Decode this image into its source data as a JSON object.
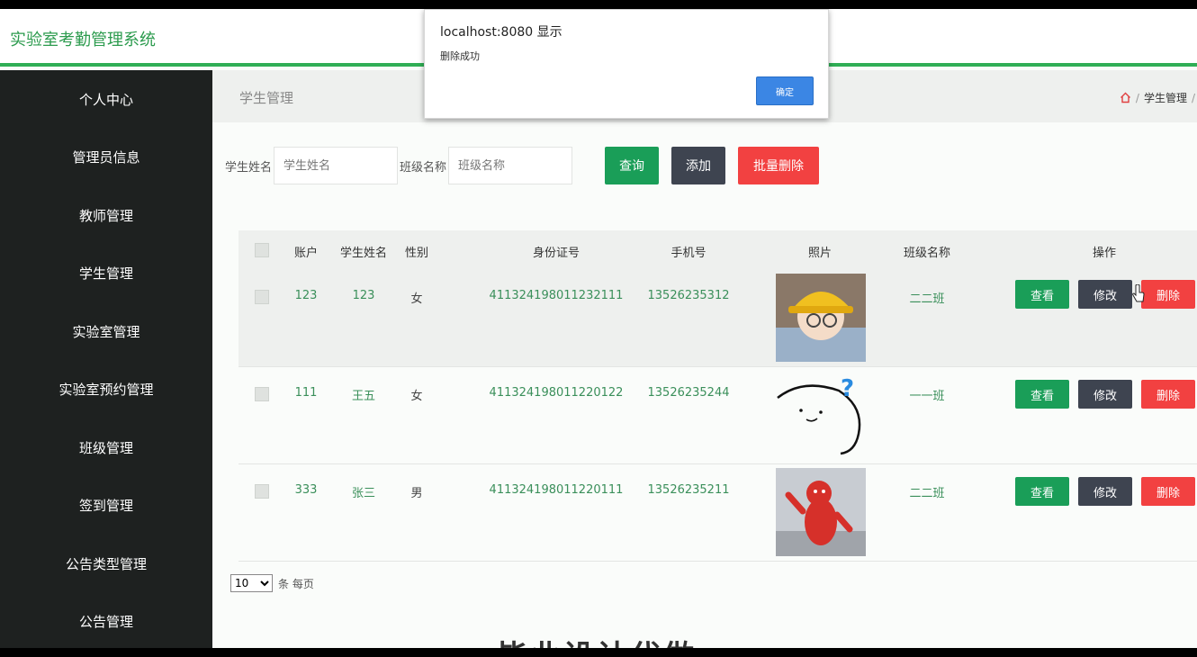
{
  "app": {
    "title": "实验室考勤管理系统"
  },
  "sidebar": {
    "items": [
      {
        "label": "个人中心"
      },
      {
        "label": "管理员信息"
      },
      {
        "label": "教师管理"
      },
      {
        "label": "学生管理"
      },
      {
        "label": "实验室管理"
      },
      {
        "label": "实验室预约管理"
      },
      {
        "label": "班级管理"
      },
      {
        "label": "签到管理"
      },
      {
        "label": "公告类型管理"
      },
      {
        "label": "公告管理"
      }
    ]
  },
  "page": {
    "title": "学生管理",
    "breadcrumb": [
      "学生管理",
      "/"
    ]
  },
  "search": {
    "name_label": "学生姓名",
    "name_placeholder": "学生姓名",
    "class_label": "班级名称",
    "class_placeholder": "班级名称",
    "query_label": "查询",
    "add_label": "添加",
    "batch_delete_label": "批量删除"
  },
  "table": {
    "headers": [
      "账户",
      "学生姓名",
      "性别",
      "身份证号",
      "手机号",
      "照片",
      "班级名称",
      "操作"
    ],
    "rows": [
      {
        "account": "123",
        "name": "123",
        "gender": "女",
        "id_number": "411324198011232111",
        "phone": "13526235312",
        "class": "二二班",
        "photo": "avatar-hardhat"
      },
      {
        "account": "111",
        "name": "王五",
        "gender": "女",
        "id_number": "411324198011220122",
        "phone": "13526235244",
        "class": "一一班",
        "photo": "avatar-doodle"
      },
      {
        "account": "333",
        "name": "张三",
        "gender": "男",
        "id_number": "411324198011220111",
        "phone": "13526235211",
        "class": "二二班",
        "photo": "avatar-bear"
      }
    ],
    "actions": {
      "view": "查看",
      "edit": "修改",
      "delete": "删除"
    }
  },
  "pagination": {
    "page_size": "10",
    "suffix": "条 每页"
  },
  "bottom_text": "毕业设计代做",
  "dialog": {
    "title": "localhost:8080 显示",
    "message": "删除成功",
    "ok_label": "确定"
  }
}
